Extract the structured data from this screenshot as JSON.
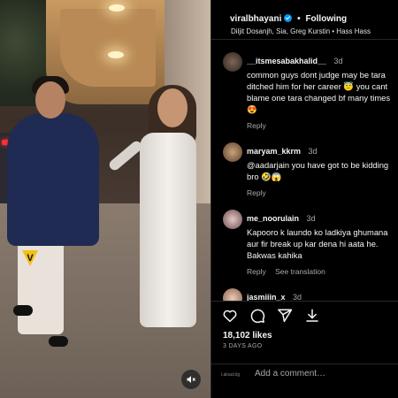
{
  "media": {
    "overlay_badge": "V"
  },
  "post": {
    "username": "viralbhayani",
    "follow_status": "Following",
    "separator": "•",
    "subtitle": "Diljit Dosanjh, Sia, Greg Kurstin • Hass Hass"
  },
  "comments": [
    {
      "username": "__itsmesabakhalid__",
      "time": "3d",
      "text": "common guys dont judge may be tara ditched him for her career 😇 you cant blame one tara changed bf many times 😍",
      "actions": [
        "Reply"
      ],
      "avatar_color": "#4a3a33"
    },
    {
      "username": "maryam_kkrm",
      "time": "3d",
      "text": "@aadarjain you have got to be kidding bro 🤣😱",
      "actions": [
        "Reply"
      ],
      "avatar_color": "#7a5b3f"
    },
    {
      "username": "me_noorulain",
      "time": "3d",
      "text": "Kapooro k laundo ko ladkiya ghumana aur fir break up kar dena hi aata he. Bakwas kahika",
      "actions": [
        "Reply",
        "See translation"
      ],
      "avatar_color": "#8a6b6b"
    },
    {
      "username": "jasmiiin_x",
      "time": "3d",
      "text": "",
      "actions": [],
      "avatar_color": "#c79f8a"
    }
  ],
  "engagement": {
    "likes": "18,102 likes",
    "date": "3 DAYS AGO"
  },
  "composer": {
    "mini_tag": "l.aload.ilg",
    "placeholder": "Add a comment…"
  },
  "colors": {
    "verified": "#0095f6",
    "secondary_text": "#a8a8a8",
    "badge": "#f2c014"
  }
}
